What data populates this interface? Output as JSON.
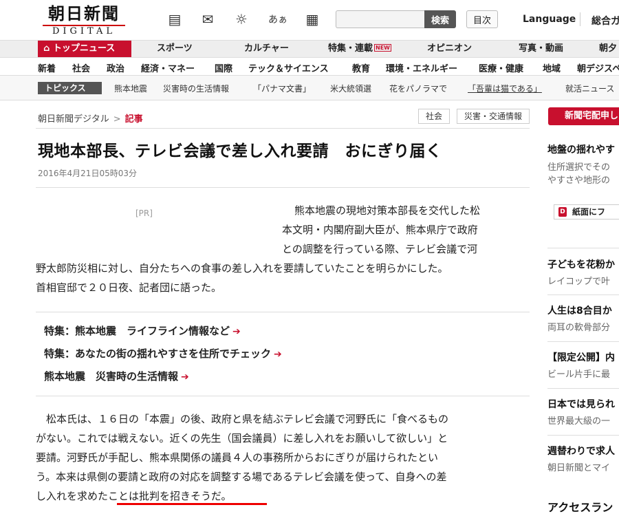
{
  "logo": {
    "main": "朝日新聞",
    "sub": "DIGITAL"
  },
  "header": {
    "icons": [
      "newspaper-icon",
      "mail-icon",
      "weather-icon",
      "hiragana-icon",
      "apps-grid-icon"
    ],
    "icon_glyphs": [
      "▤",
      "✉",
      "☼",
      "あぁ",
      "▦"
    ],
    "search_button": "検索",
    "toc_button": "目次",
    "language": "Language",
    "general_guide": "総合ガ"
  },
  "nav1": {
    "top_news": "トップニュース",
    "items": [
      "スポーツ",
      "カルチャー",
      "特集・連載",
      "オピニオン",
      "写真・動画",
      "朝夕"
    ],
    "new_badge": "NEW"
  },
  "nav2": {
    "items": [
      "新着",
      "社会",
      "政治",
      "経済・マネー",
      "国際",
      "テック＆サイエンス",
      "教育",
      "環境・エネルギー",
      "医療・健康",
      "地域",
      "朝デジスペ"
    ]
  },
  "topics": {
    "label": "トピックス",
    "items": [
      "熊本地震",
      "災害時の生活情報",
      "「パナマ文書」",
      "米大統領選",
      "花をパノラマで",
      "「吾輩は猫である」",
      "就活ニュース"
    ]
  },
  "breadcrumb": {
    "home": "朝日新聞デジタル",
    "separator": ">",
    "current": "記事"
  },
  "tags": [
    "社会",
    "災害・交通情報"
  ],
  "article": {
    "title": "現地本部長、テレビ会議で差し入れ要請　おにぎり届く",
    "date": "2016年4月21日05時03分",
    "pr": "[PR]",
    "lead": [
      "熊本地震の現地対策本部長を交代した松",
      "本文明・内閣府副大臣が、熊本県庁で政府",
      "との調整を行っている際、テレビ会議で河",
      "野太郎防災相に対し、自分たちへの食事の差し入れを要請していたことを明らかにした。",
      "首相官邸で２０日夜、記者団に語った。"
    ],
    "related_links": [
      "特集：熊本地震　ライフライン情報など",
      "特集：あなたの街の揺れやすさを住所でチェック",
      "熊本地震　災害時の生活情報"
    ],
    "body": [
      "　松本氏は、１６日の「本震」の後、政府と県を結ぶテレビ会議で河野氏に「食べるもの",
      "がない。これでは戦えない。近くの先生（国会議員）に差し入れをお願いして欲しい」と",
      "要請。河野氏が手配し、熊本県関係の議員４人の事務所からおにぎりが届けられたとい",
      "う。本来は県側の要請と政府の対応を調整する場であるテレビ会議を使って、自身への差",
      "し入れを求めたことは批判を招きそうだ。"
    ]
  },
  "sidebar": {
    "delivery_button": "新聞宅配申し",
    "shimen_button": "紙面にフ",
    "items": [
      {
        "head": "地盤の揺れやす",
        "sub": [
          "住所選択でその",
          "やすさや地形の"
        ]
      },
      {
        "head": "子どもを花粉か",
        "sub": [
          "レイコップで叶"
        ]
      },
      {
        "head": "人生は8合目か",
        "sub": [
          "両耳の軟骨部分"
        ]
      },
      {
        "head": "【限定公開】内",
        "sub": [
          "ビール片手に最"
        ]
      },
      {
        "head": "日本では見られ",
        "sub": [
          "世界最大級の一"
        ]
      },
      {
        "head": "週替わりで求人",
        "sub": [
          "朝日新聞とマイ"
        ]
      }
    ],
    "ranking": "アクセスラン"
  }
}
